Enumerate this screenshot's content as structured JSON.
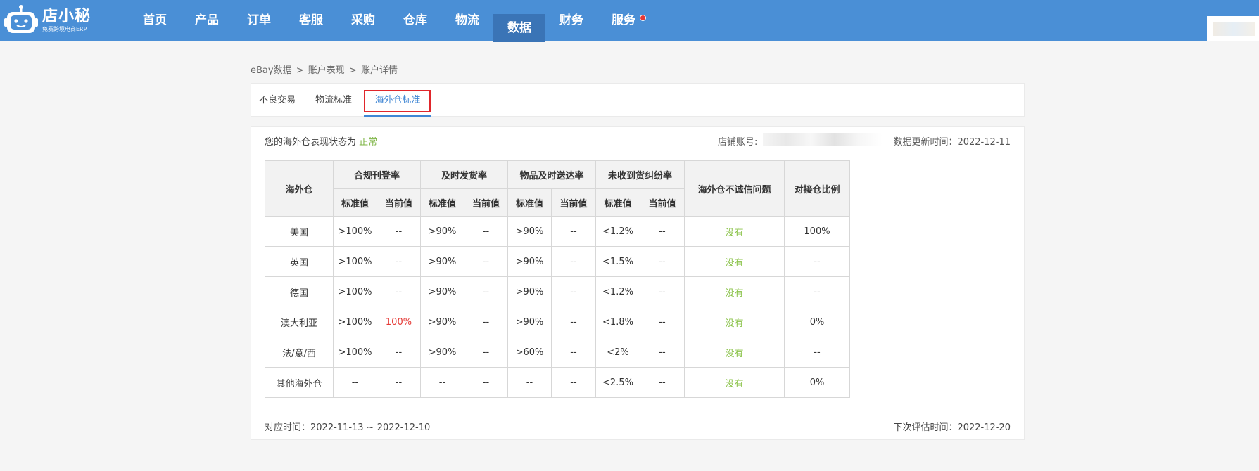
{
  "header": {
    "logo_name": "店小秘",
    "logo_tagline": "免费跨境电商ERP",
    "nav": [
      {
        "label": "首页"
      },
      {
        "label": "产品"
      },
      {
        "label": "订单"
      },
      {
        "label": "客服"
      },
      {
        "label": "采购"
      },
      {
        "label": "仓库"
      },
      {
        "label": "物流"
      },
      {
        "label": "数据",
        "active": true
      },
      {
        "label": "财务"
      },
      {
        "label": "服务",
        "badge": true
      }
    ]
  },
  "breadcrumb": [
    "eBay数据",
    "账户表现",
    "账户详情"
  ],
  "breadcrumb_sep": ">",
  "tabs": [
    "不良交易",
    "物流标准",
    "海外仓标准"
  ],
  "summary": {
    "status_prefix": "您的海外仓表现状态为",
    "status_value": "正常",
    "shop_label": "店铺账号:",
    "update_label": "数据更新时间：2022-12-11"
  },
  "table": {
    "col_warehouse": "海外仓",
    "groups": [
      "合规刊登率",
      "及时发货率",
      "物品及时送达率",
      "未收到货纠纷率"
    ],
    "sub_std": "标准值",
    "sub_cur": "当前值",
    "col_dishonest": "海外仓不诚信问题",
    "col_ratio": "对接仓比例",
    "rows": [
      {
        "name": "美国",
        "c1": ">100%",
        "c2": "--",
        "c3": ">90%",
        "c4": "--",
        "c5": ">90%",
        "c6": "--",
        "c7": "<1.2%",
        "c8": "--",
        "dis": "没有",
        "ratio": "100%"
      },
      {
        "name": "英国",
        "c1": ">100%",
        "c2": "--",
        "c3": ">90%",
        "c4": "--",
        "c5": ">90%",
        "c6": "--",
        "c7": "<1.5%",
        "c8": "--",
        "dis": "没有",
        "ratio": "--"
      },
      {
        "name": "德国",
        "c1": ">100%",
        "c2": "--",
        "c3": ">90%",
        "c4": "--",
        "c5": ">90%",
        "c6": "--",
        "c7": "<1.2%",
        "c8": "--",
        "dis": "没有",
        "ratio": "--"
      },
      {
        "name": "澳大利亚",
        "c1": ">100%",
        "c2": "100%",
        "c3": ">90%",
        "c4": "--",
        "c5": ">90%",
        "c6": "--",
        "c7": "<1.8%",
        "c8": "--",
        "dis": "没有",
        "ratio": "0%"
      },
      {
        "name": "法/意/西",
        "c1": ">100%",
        "c2": "--",
        "c3": ">90%",
        "c4": "--",
        "c5": ">60%",
        "c6": "--",
        "c7": "<2%",
        "c8": "--",
        "dis": "没有",
        "ratio": "--"
      },
      {
        "name": "其他海外仓",
        "c1": "--",
        "c2": "--",
        "c3": "--",
        "c4": "--",
        "c5": "--",
        "c6": "--",
        "c7": "<2.5%",
        "c8": "--",
        "dis": "没有",
        "ratio": "0%"
      }
    ]
  },
  "footer": {
    "period": "对应时间：2022-11-13 ~ 2022-12-10",
    "next_eval": "下次评估时间：2022-12-20"
  },
  "colors": {
    "topbar": "#4a8fd6",
    "nav_active": "#3a74b6",
    "ok_green": "#8bc34a",
    "alert_red": "#e53935",
    "tab_highlight": "#e0262b"
  }
}
